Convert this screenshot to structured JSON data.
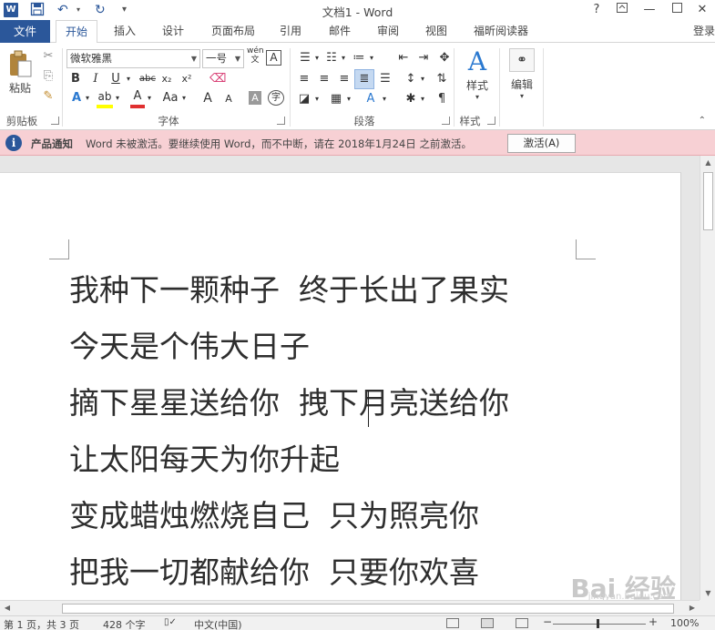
{
  "titlebar": {
    "app_icon": "W",
    "title": "文档1 - Word",
    "help": "?",
    "icons": [
      "word-app-icon",
      "save-icon",
      "undo-icon",
      "redo-icon",
      "customize-qat-icon"
    ]
  },
  "tabs": {
    "file": "文件",
    "items": [
      "开始",
      "插入",
      "设计",
      "页面布局",
      "引用",
      "邮件",
      "审阅",
      "视图",
      "福昕阅读器"
    ],
    "active": "开始",
    "login": "登录"
  },
  "ribbon": {
    "clipboard": {
      "paste": "粘贴",
      "label": "剪贴板"
    },
    "font": {
      "name": "微软雅黑",
      "size": "一号",
      "phonetic": "wén\n文",
      "buttons": [
        "B",
        "I",
        "U",
        "abc",
        "x₂",
        "x²",
        "A",
        "A",
        "A",
        "Aa",
        "A",
        "A",
        "A",
        "字"
      ],
      "label": "字体"
    },
    "paragraph": {
      "label": "段落"
    },
    "styles": {
      "button": "样式",
      "label": "样式"
    },
    "editing": {
      "button": "编辑"
    }
  },
  "notification": {
    "title": "产品通知",
    "message": "Word 未被激活。要继续使用 Word，而不中断，请在 2018年1月24日 之前激活。",
    "button": "激活(A)"
  },
  "document": {
    "lines": [
      "我种下一颗种子  终于长出了果实",
      "今天是个伟大日子",
      "摘下星星送给你  拽下月亮送给你",
      "让太阳每天为你升起",
      "变成蜡烛燃烧自己  只为照亮你",
      "把我一切都献给你  只要你欢喜"
    ],
    "watermark": "Bai 经验",
    "watermark_sub": "jingyan.baidu.com"
  },
  "status": {
    "page": "第 1 页，共 3 页",
    "words": "428 个字",
    "language": "中文(中国)",
    "zoom_minus": "−",
    "zoom_plus": "+",
    "zoom": "100%"
  }
}
